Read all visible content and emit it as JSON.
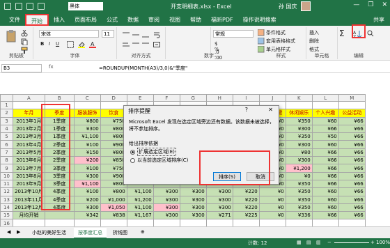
{
  "titlebar": {
    "font_value": "黑体",
    "title": "开支明细表.xlsx  -  Excel",
    "user": "孙 国庆",
    "minimize": "—",
    "restore": "❐",
    "close": "✕"
  },
  "tabs": [
    "文件",
    "开始",
    "插入",
    "页面布局",
    "公式",
    "数据",
    "审阅",
    "视图",
    "帮助",
    "福昕PDF",
    "操作说明搜索"
  ],
  "share": "共享",
  "ribbon": {
    "clipboard_label": "剪贴板",
    "font_name": "宋体",
    "font_size": "11",
    "font_label": "字体",
    "align_label": "对齐方式",
    "number_format": "常规",
    "number_label": "数字",
    "cond_format": "条件格式",
    "table_format": "套用表格格式",
    "cell_style": "单元格样式",
    "style_label": "样式",
    "insert": "插入",
    "delete": "删除",
    "format": "格式",
    "cells_label": "单元格",
    "edit_label": "编辑"
  },
  "formula_bar": {
    "name_box": "B3",
    "fx": "fx",
    "formula": "=ROUNDUP(MONTH(A3)/3,0)&\"季度\""
  },
  "sheet": {
    "columns": [
      "A",
      "B",
      "C",
      "D",
      "E",
      "F",
      "G",
      "H",
      "I",
      "J",
      "K",
      "L",
      "M"
    ],
    "headers": [
      "年月",
      "季度",
      "服装服饰",
      "饮食",
      "",
      "",
      "",
      "",
      "",
      "医疗保健",
      "休闲娱乐",
      "个人兴趣",
      "公益活动"
    ],
    "rows": [
      [
        "2013年1月",
        "1季度",
        "¥800",
        "¥750",
        "",
        "",
        "",
        "",
        "",
        "¥0",
        "¥350",
        "¥60",
        "¥66"
      ],
      [
        "2013年2月",
        "1季度",
        "¥300",
        "¥800",
        "",
        "",
        "",
        "",
        "",
        "¥0",
        "¥300",
        "¥66",
        "¥66"
      ],
      [
        "2013年3月",
        "1季度",
        "¥1,100",
        "¥800",
        "",
        "",
        "",
        "",
        "",
        "¥0",
        "¥350",
        "¥50",
        "¥66"
      ],
      [
        "2013年4月",
        "2季度",
        "¥100",
        "¥900",
        "",
        "",
        "",
        "",
        "",
        "¥0",
        "¥300",
        "¥60",
        "¥66"
      ],
      [
        "2013年5月",
        "2季度",
        "¥150",
        "¥800",
        "",
        "",
        "",
        "",
        "",
        "¥0",
        "¥80",
        "¥66",
        "¥66"
      ],
      [
        "2013年6月",
        "2季度",
        "¥200",
        "¥850",
        "",
        "",
        "",
        "",
        "",
        "¥0",
        "¥300",
        "¥66",
        "¥66"
      ],
      [
        "2013年7月",
        "3季度",
        "¥100",
        "¥750",
        "",
        "",
        "",
        "",
        "",
        "¥0",
        "¥1,200",
        "¥66",
        "¥66"
      ],
      [
        "2013年8月",
        "3季度",
        "¥300",
        "¥900",
        "",
        "",
        "",
        "",
        "",
        "¥0",
        "¥0",
        "¥66",
        "¥66"
      ],
      [
        "2013年9月",
        "3季度",
        "¥1,100",
        "¥800",
        "",
        "",
        "",
        "",
        "",
        "¥0",
        "¥350",
        "¥66",
        "¥66"
      ],
      [
        "2013年10月",
        "4季度",
        "¥100",
        "¥800",
        "¥1,100",
        "¥300",
        "¥300",
        "¥300",
        "¥220",
        "¥0",
        "¥350",
        "¥60",
        "¥66"
      ],
      [
        "2013年11月",
        "4季度",
        "¥200",
        "¥1,000",
        "¥1,200",
        "¥300",
        "¥300",
        "¥300",
        "¥220",
        "¥0",
        "¥350",
        "¥60",
        "¥66"
      ],
      [
        "2013年12月",
        "4季度",
        "¥300",
        "¥1,050",
        "¥1,100",
        "¥300",
        "¥300",
        "¥300",
        "¥220",
        "¥0",
        "¥350",
        "¥60",
        "¥66"
      ],
      [
        "月均开销",
        "",
        "¥342",
        "¥838",
        "¥1,167",
        "¥300",
        "¥300",
        "¥271",
        "¥225",
        "¥0",
        "¥336",
        "¥66",
        "¥66"
      ]
    ],
    "row_numbers": [
      "1",
      "2",
      "3",
      "4",
      "5",
      "6",
      "7",
      "8",
      "9",
      "10",
      "11",
      "12",
      "13",
      "14",
      "15",
      "16"
    ]
  },
  "sheet_tabs": [
    "小赵的美好生活",
    "按季度汇总",
    "折线图"
  ],
  "active_sheet": "按季度汇总",
  "status": {
    "count": "计数: 12",
    "zoom": "100%"
  },
  "dialog": {
    "title": "排序提醒",
    "help": "?",
    "close": "✕",
    "message": "Microsoft Excel 发现在选定区域旁边还有数据。该数据未被选择，将不参加排序。",
    "group_label": "给出排序依据",
    "option1": "扩展选定区域(E)",
    "option2": "以当前选定区域排序(C)",
    "sort_button": "排序(S)",
    "cancel_button": "取消"
  },
  "colors": {
    "excel_green": "#217346",
    "header_fill": "#ffff00",
    "data_fill": "#c6e0b4",
    "pink_fill": "#ffc0cb",
    "highlight_red": "#e33333"
  }
}
